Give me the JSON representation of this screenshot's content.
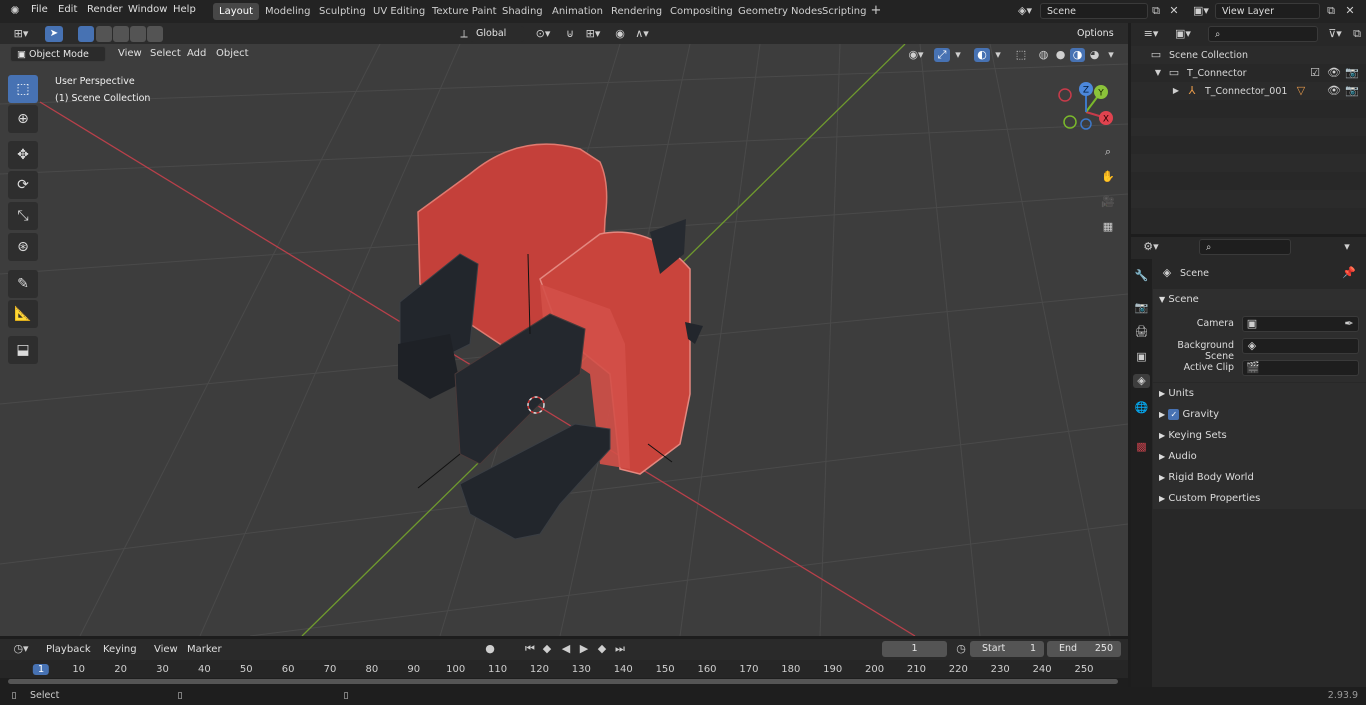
{
  "topbar": {
    "menus": [
      "File",
      "Edit",
      "Render",
      "Window",
      "Help"
    ],
    "workspaces": [
      "Layout",
      "Modeling",
      "Sculpting",
      "UV Editing",
      "Texture Paint",
      "Shading",
      "Animation",
      "Rendering",
      "Compositing",
      "Geometry Nodes",
      "Scripting"
    ],
    "active_workspace": "Layout",
    "add_tab": "+",
    "scene": "Scene",
    "view_layer": "View Layer"
  },
  "viewport_header": {
    "mode": "Object Mode",
    "menus": [
      "View",
      "Select",
      "Add",
      "Object"
    ],
    "orientation": "Global",
    "options": "Options"
  },
  "viewport": {
    "perspective_label": "User Perspective",
    "collection_label": "(1) Scene Collection",
    "gizmo_axes": [
      "X",
      "Y",
      "Z"
    ]
  },
  "outliner": {
    "search_placeholder": "",
    "rows": [
      {
        "label": "Scene Collection"
      },
      {
        "label": "T_Connector"
      },
      {
        "label": "T_Connector_001"
      }
    ]
  },
  "properties": {
    "header": "Scene",
    "panel_title": "Scene",
    "fields": [
      {
        "label": "Camera",
        "value": ""
      },
      {
        "label": "Background Scene",
        "value": ""
      },
      {
        "label": "Active Clip",
        "value": ""
      }
    ],
    "sections": [
      "Units",
      "Gravity",
      "Keying Sets",
      "Audio",
      "Rigid Body World",
      "Custom Properties"
    ]
  },
  "timeline": {
    "menus": [
      "Playback",
      "Keying",
      "View",
      "Marker"
    ],
    "current_frame": "1",
    "start_label": "Start",
    "start_value": "1",
    "end_label": "End",
    "end_value": "250",
    "frame_numbers": [
      "1",
      "10",
      "20",
      "30",
      "40",
      "50",
      "60",
      "70",
      "80",
      "90",
      "100",
      "110",
      "120",
      "130",
      "140",
      "150",
      "160",
      "170",
      "180",
      "190",
      "200",
      "210",
      "220",
      "230",
      "240",
      "250"
    ]
  },
  "status": {
    "select": "Select",
    "version": "2.93.9"
  },
  "colors": {
    "accent": "#4772b3",
    "object_red": "#d8473f",
    "axis_x": "#d8474f",
    "axis_y": "#7cba2e"
  }
}
